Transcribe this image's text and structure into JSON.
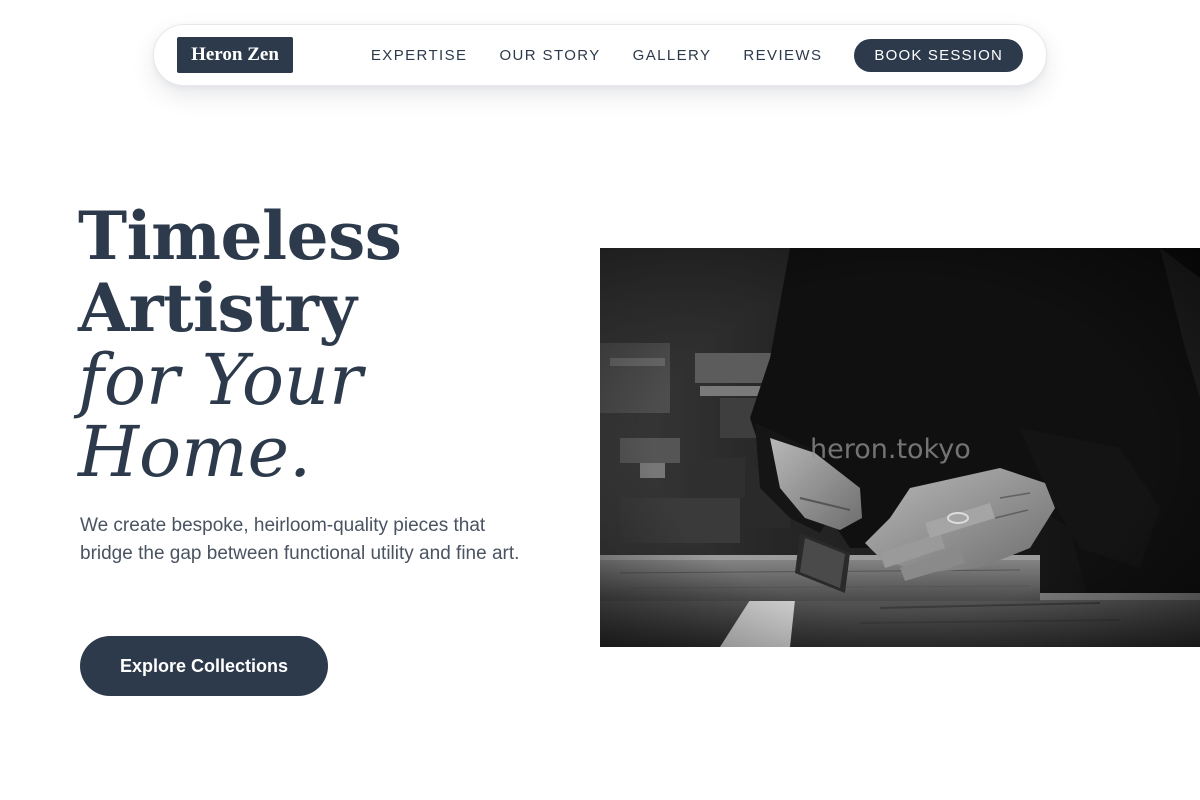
{
  "nav": {
    "brand": "Heron Zen",
    "links": [
      "EXPERTISE",
      "OUR STORY",
      "GALLERY",
      "REVIEWS"
    ],
    "cta": "BOOK SESSION"
  },
  "hero": {
    "title_line1": "Timeless",
    "title_line2": "Artistry",
    "title_line3": "for Your",
    "title_line4": "Home.",
    "subtitle": "We create bespoke, heirloom-quality pieces that bridge the gap between functional utility and fine art.",
    "cta": "Explore Collections",
    "image": {
      "description": "black-and-white photo of craftsman sawing wood",
      "watermark": "heron.tokyo"
    }
  },
  "colors": {
    "primary": "#2c3a4c",
    "text_muted": "#4a5361",
    "background": "#ffffff"
  }
}
